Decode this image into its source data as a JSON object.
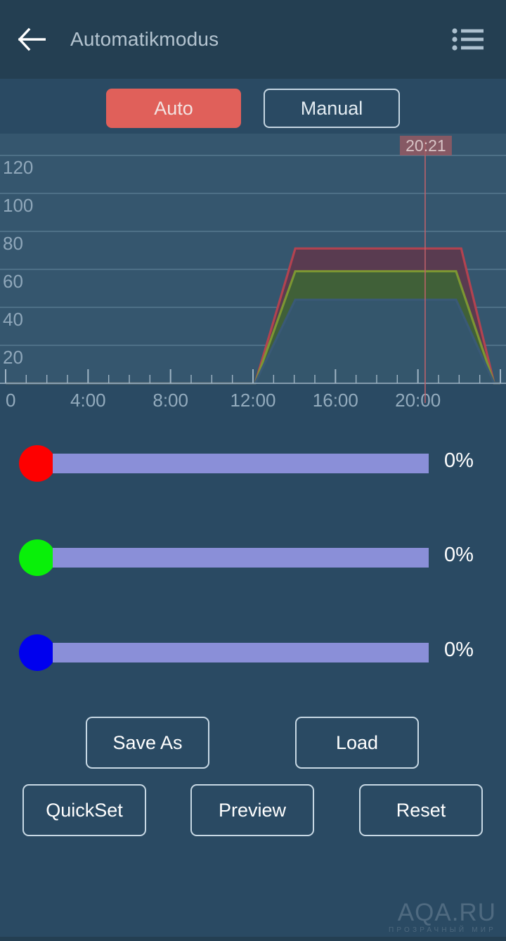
{
  "header": {
    "title": "Automatikmodus",
    "back_icon": "back-arrow-icon",
    "menu_icon": "list-menu-icon"
  },
  "modes": {
    "auto_label": "Auto",
    "manual_label": "Manual",
    "active": "Auto",
    "active_bg": "#e0605a",
    "outline_color": "#c5d6e2"
  },
  "chart_data": {
    "type": "area",
    "title": "",
    "xlabel": "",
    "ylabel": "",
    "xlim": [
      0,
      24
    ],
    "ylim": [
      0,
      130
    ],
    "yticks": [
      120,
      100,
      80,
      60,
      40,
      20
    ],
    "ytick_labels": [
      "120",
      "100",
      "80",
      "60",
      "40",
      "20"
    ],
    "xticks": [
      0,
      4,
      8,
      12,
      16,
      20
    ],
    "xtick_labels": [
      "0",
      "4:00",
      "8:00",
      "12:00",
      "16:00",
      "20:00"
    ],
    "minor_tick_interval_hours": 1,
    "grid": true,
    "grid_color": "#57798f",
    "plot_bg": "#35566e",
    "legend": "none",
    "marker": {
      "label": "20:21",
      "x_hours": 20.35,
      "line_color": "#c0626b",
      "badge_bg": "#9e5a62",
      "badge_text_color": "#d8c4c6"
    },
    "series": [
      {
        "name": "Red channel",
        "color": "#b8424f",
        "fill": "#5c3a4e",
        "x": [
          0,
          12.1,
          14.05,
          22.1,
          23.7,
          24
        ],
        "values": [
          0,
          0,
          71,
          71,
          0,
          0
        ]
      },
      {
        "name": "Green channel",
        "color": "#7f9a32",
        "fill": "#3f6237",
        "x": [
          0,
          12.1,
          14.05,
          21.85,
          23.7,
          24
        ],
        "values": [
          0,
          0,
          59,
          59,
          0,
          0
        ]
      },
      {
        "name": "Blue channel",
        "color": "#3a5a78",
        "fill": "#34556f",
        "x": [
          0,
          12.1,
          14.05,
          21.85,
          23.7,
          24
        ],
        "values": [
          0,
          0,
          44,
          44,
          0,
          0
        ]
      }
    ]
  },
  "sliders": [
    {
      "channel": "red",
      "thumb_color": "#fe0000",
      "value_label": "0%",
      "percent": 0,
      "track_color": "#8a8fd8"
    },
    {
      "channel": "green",
      "thumb_color": "#09f009",
      "value_label": "0%",
      "percent": 0,
      "track_color": "#8a8fd8"
    },
    {
      "channel": "blue",
      "thumb_color": "#0000ee",
      "value_label": "0%",
      "percent": 0,
      "track_color": "#8a8fd8"
    }
  ],
  "actions": {
    "save_as": "Save As",
    "load": "Load",
    "quickset": "QuickSet",
    "preview": "Preview",
    "reset": "Reset"
  },
  "watermark": {
    "main": "AQA.RU",
    "sub": "ПРОЗРАЧНЫЙ МИР"
  }
}
